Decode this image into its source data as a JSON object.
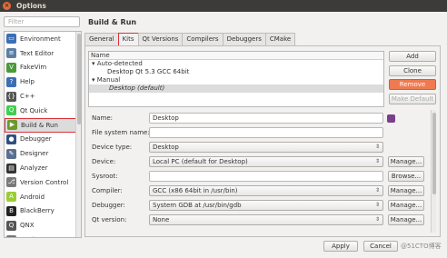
{
  "window": {
    "title": "Options"
  },
  "filter": {
    "placeholder": "Filter"
  },
  "sidebar": {
    "items": [
      {
        "label": "Environment",
        "icon": "monitor-icon",
        "color": "#3c6eb4"
      },
      {
        "label": "Text Editor",
        "icon": "text-editor-icon",
        "color": "#5a7fa6"
      },
      {
        "label": "FakeVim",
        "icon": "fakevim-icon",
        "color": "#4a9a3a"
      },
      {
        "label": "Help",
        "icon": "help-icon",
        "color": "#3c6eb4"
      },
      {
        "label": "C++",
        "icon": "cpp-icon",
        "color": "#555555"
      },
      {
        "label": "Qt Quick",
        "icon": "qt-quick-icon",
        "color": "#41cd52"
      },
      {
        "label": "Build & Run",
        "icon": "build-run-icon",
        "color": "#6a9a2a"
      },
      {
        "label": "Debugger",
        "icon": "debugger-icon",
        "color": "#2f4f7f"
      },
      {
        "label": "Designer",
        "icon": "designer-icon",
        "color": "#5a6f8f"
      },
      {
        "label": "Analyzer",
        "icon": "analyzer-icon",
        "color": "#333333"
      },
      {
        "label": "Version Control",
        "icon": "version-control-icon",
        "color": "#7a7a7a"
      },
      {
        "label": "Android",
        "icon": "android-icon",
        "color": "#9acd32"
      },
      {
        "label": "BlackBerry",
        "icon": "blackberry-icon",
        "color": "#222222"
      },
      {
        "label": "QNX",
        "icon": "qnx-icon",
        "color": "#555555"
      },
      {
        "label": "Devices",
        "icon": "devices-icon",
        "color": "#777777"
      }
    ],
    "selected": "Build & Run"
  },
  "page": {
    "title": "Build & Run"
  },
  "tabs": [
    {
      "label": "General"
    },
    {
      "label": "Kits"
    },
    {
      "label": "Qt Versions"
    },
    {
      "label": "Compilers"
    },
    {
      "label": "Debuggers"
    },
    {
      "label": "CMake"
    }
  ],
  "kits_list": {
    "header": "Name",
    "auto_group": "Auto-detected",
    "auto_item": "Desktop Qt 5.3 GCC 64bit",
    "manual_group": "Manual",
    "manual_item": "Desktop (default)"
  },
  "side_buttons": {
    "add": "Add",
    "clone": "Clone",
    "remove": "Remove",
    "make_default": "Make Default"
  },
  "form": {
    "name_label": "Name:",
    "name_value": "Desktop",
    "fs_label": "File system name:",
    "fs_value": "",
    "device_type_label": "Device type:",
    "device_type_value": "Desktop",
    "device_label": "Device:",
    "device_value": "Local PC (default for Desktop)",
    "sysroot_label": "Sysroot:",
    "sysroot_value": "",
    "compiler_label": "Compiler:",
    "compiler_value": "GCC (x86 64bit in /usr/bin)",
    "debugger_label": "Debugger:",
    "debugger_value": "System GDB at /usr/bin/gdb",
    "qt_label": "Qt version:",
    "qt_value": "None",
    "manage": "Manage...",
    "browse": "Browse..."
  },
  "footer": {
    "apply": "Apply",
    "cancel": "Cancel",
    "ok": "OK"
  },
  "watermark": "@51CTO博客"
}
